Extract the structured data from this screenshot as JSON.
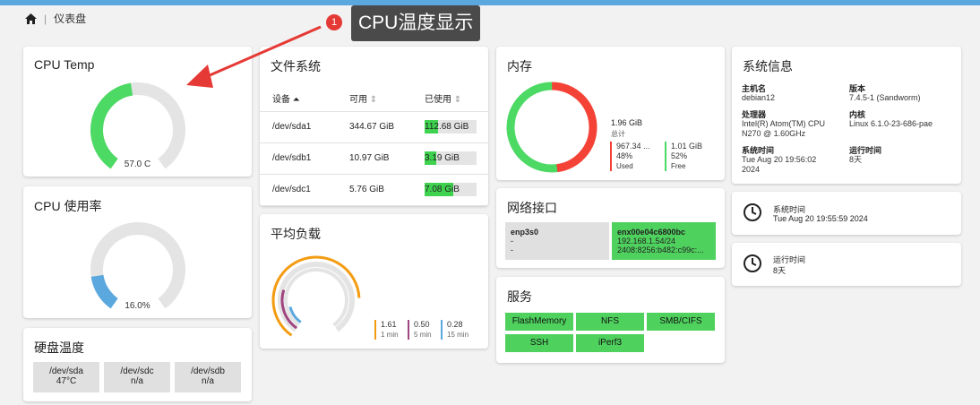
{
  "breadcrumb": {
    "home_icon": "home-icon",
    "label": "仪表盘"
  },
  "annotation": {
    "badge": "1",
    "label": "CPU温度显示"
  },
  "cpu_temp": {
    "title": "CPU Temp",
    "value_label": "57.0 C",
    "level": 0.47,
    "color": "#4cd964"
  },
  "cpu_usage": {
    "title": "CPU 使用率",
    "value_label": "16.0%",
    "level": 0.16,
    "color": "#5aa8de"
  },
  "disk_temp": {
    "title": "硬盘温度",
    "tiles": [
      {
        "name": "/dev/sda",
        "value": "47°C"
      },
      {
        "name": "/dev/sdc",
        "value": "n/a"
      },
      {
        "name": "/dev/sdb",
        "value": "n/a"
      }
    ]
  },
  "filesystem": {
    "title": "文件系统",
    "headers": {
      "device": "设备",
      "avail": "可用",
      "used": "已使用"
    },
    "rows": [
      {
        "device": "/dev/sda1",
        "avail": "344.67 GiB",
        "used": "112.68 GiB",
        "used_fraction": 0.25
      },
      {
        "device": "/dev/sdb1",
        "avail": "10.97 GiB",
        "used": "3.19 GiB",
        "used_fraction": 0.23
      },
      {
        "device": "/dev/sdc1",
        "avail": "5.76 GiB",
        "used": "7.08 GiB",
        "used_fraction": 0.55
      }
    ]
  },
  "load_avg": {
    "title": "平均负载",
    "items": [
      {
        "value": "1.61",
        "label": "1 min",
        "color": "#f39c12",
        "level": 0.8
      },
      {
        "value": "0.50",
        "label": "5 min",
        "color": "#a0457f",
        "level": 0.25
      },
      {
        "value": "0.28",
        "label": "15 min",
        "color": "#5aa8de",
        "level": 0.14
      }
    ]
  },
  "memory": {
    "title": "内存",
    "total": "1.96 GiB",
    "total_label": "总计",
    "used": {
      "value": "967.34 ...",
      "pct": "48%",
      "label": "Used",
      "color": "#f44336",
      "fraction": 0.48
    },
    "free": {
      "value": "1.01 GiB",
      "pct": "52%",
      "label": "Free",
      "color": "#4cd964",
      "fraction": 0.52
    }
  },
  "network": {
    "title": "网络接口",
    "interfaces": [
      {
        "name": "enp3s0",
        "line1": "-",
        "line2": "-",
        "active": false
      },
      {
        "name": "enx00e04c6800bc",
        "line1": "192.168.1.54/24",
        "line2": "2408:8256:b482:c99c:...",
        "active": true
      }
    ]
  },
  "services": {
    "title": "服务",
    "items": [
      "FlashMemory",
      "NFS",
      "SMB/CIFS",
      "SSH",
      "iPerf3"
    ]
  },
  "sysinfo": {
    "title": "系统信息",
    "hostname_label": "主机名",
    "hostname": "debian12",
    "version_label": "版本",
    "version": "7.4.5-1 (Sandworm)",
    "cpu_label": "处理器",
    "cpu_line1": "Intel(R) Atom(TM) CPU",
    "cpu_line2": "N270 @ 1.60GHz",
    "kernel_label": "内核",
    "kernel": "Linux 6.1.0-23-686-pae",
    "time_label": "系统时间",
    "time_line1": "Tue Aug 20 19:56:02",
    "time_line2": "2024",
    "uptime_label": "运行时间",
    "uptime": "8天"
  },
  "systime_card": {
    "icon": "clock-icon",
    "label": "系统时间",
    "value": "Tue Aug 20 19:55:59 2024"
  },
  "uptime_card": {
    "icon": "clock-icon",
    "label": "运行时间",
    "value": "8天"
  }
}
